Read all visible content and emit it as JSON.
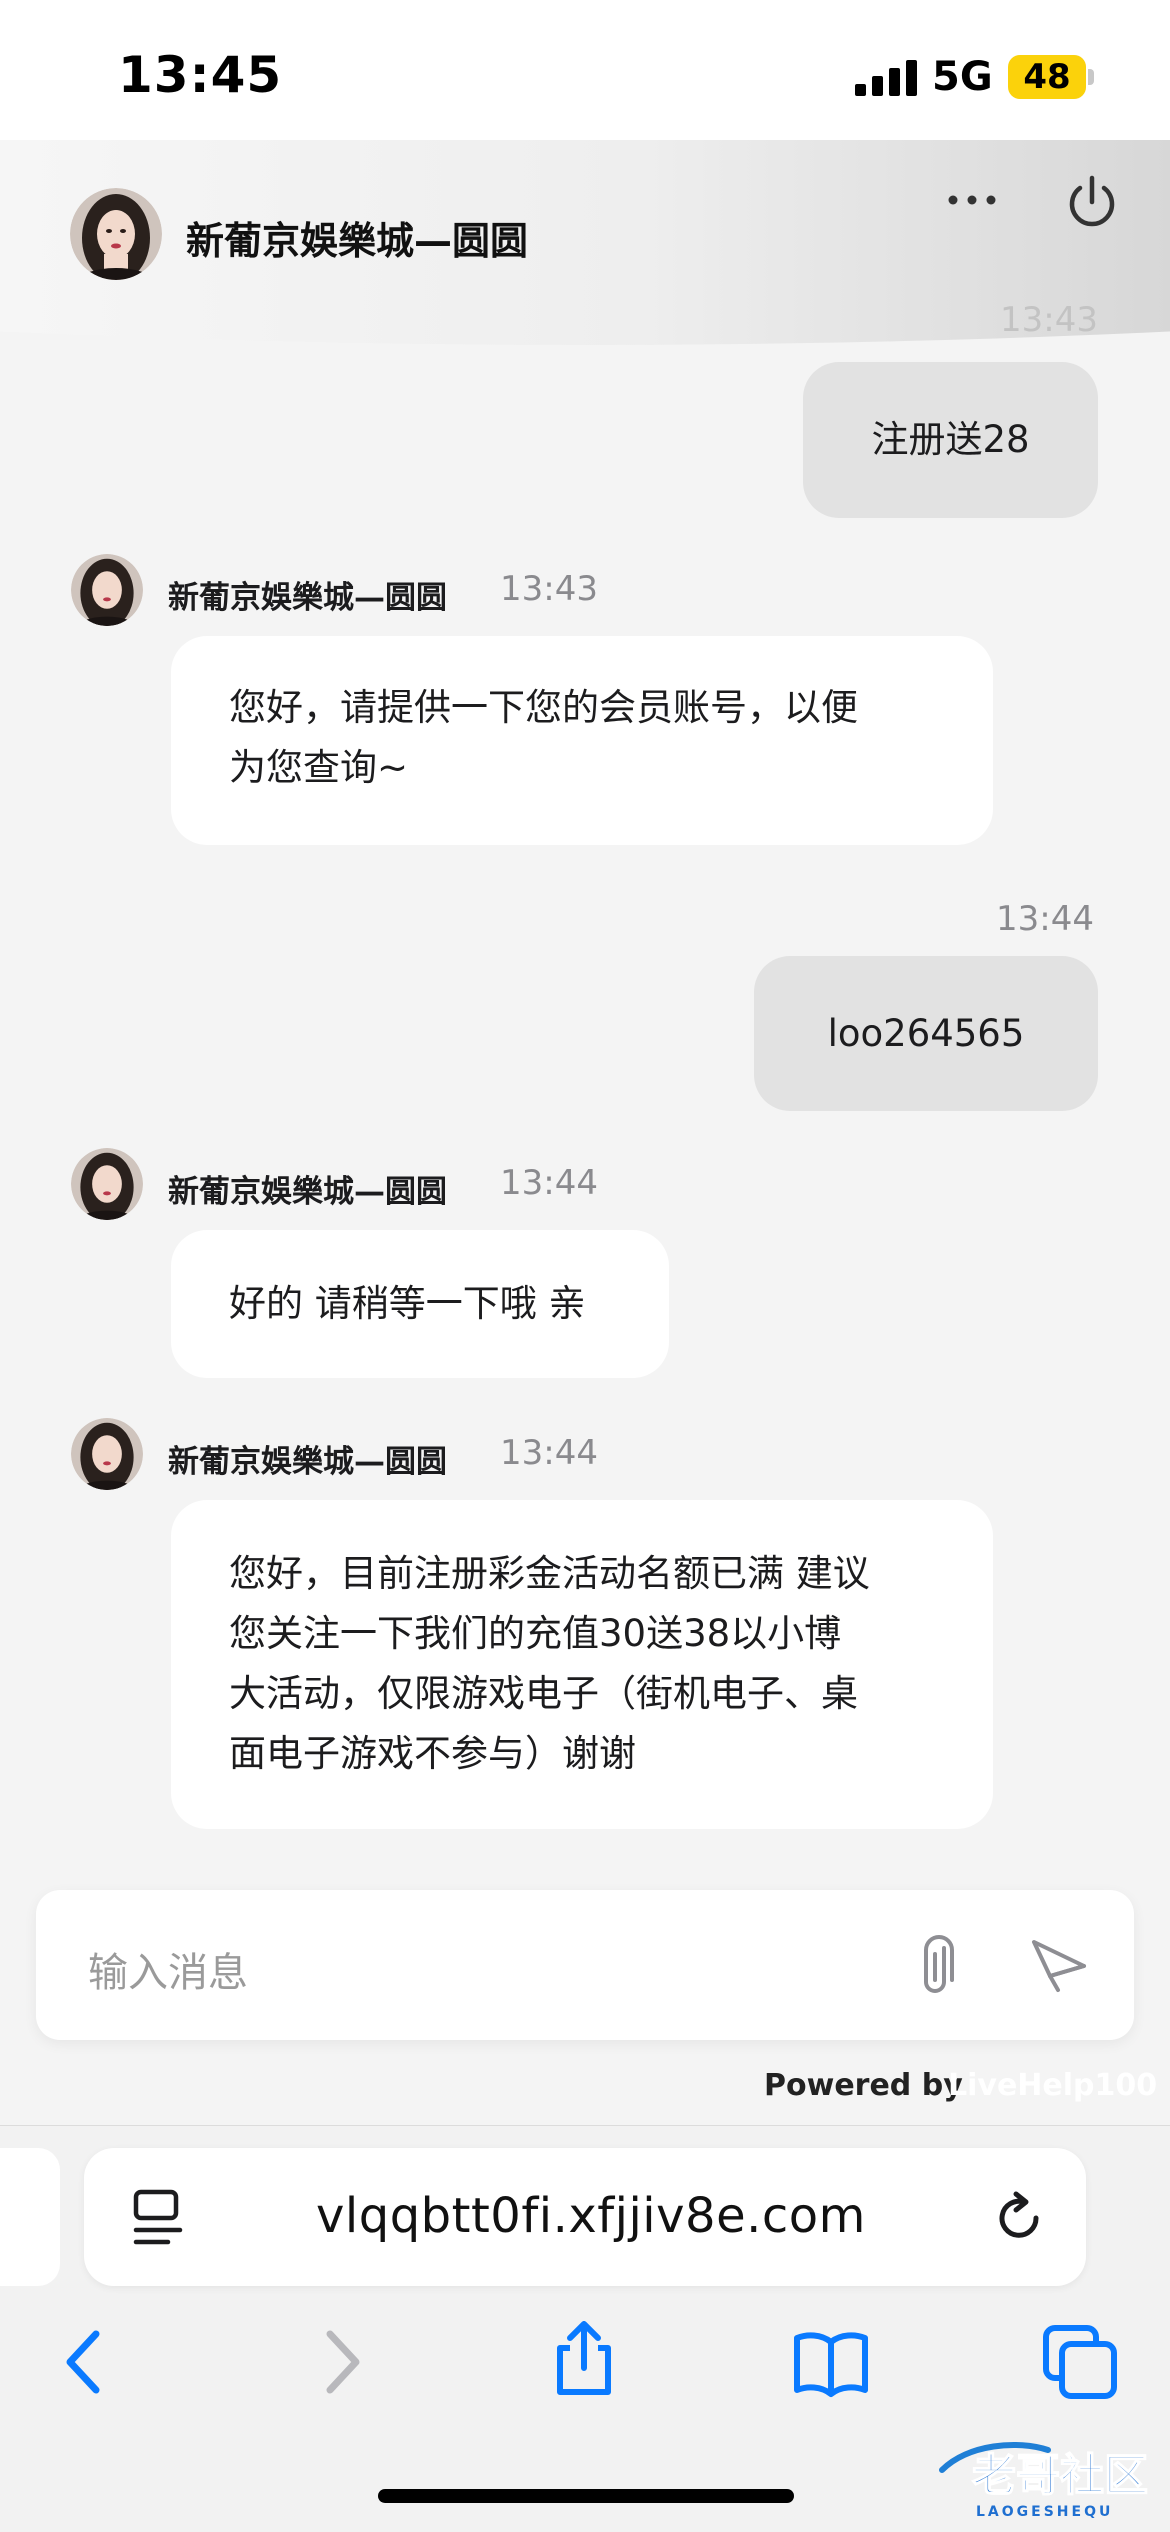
{
  "status_bar": {
    "time": "13:45",
    "network": "5G",
    "battery": "48"
  },
  "header": {
    "title": "新葡京娛樂城—圆圆",
    "more_icon": "ellipsis-icon",
    "power_icon": "power-icon"
  },
  "messages": [
    {
      "from": "user",
      "time": "13:43",
      "text": "注册送28"
    },
    {
      "from": "agent",
      "sender": "新葡京娛樂城—圆圆",
      "time": "13:43",
      "lines": [
        "您好，请提供一下您的会员账号，以便",
        "为您查询~"
      ]
    },
    {
      "from": "user",
      "time": "13:44",
      "text": "loo264565"
    },
    {
      "from": "agent",
      "sender": "新葡京娛樂城—圆圆",
      "time": "13:44",
      "lines": [
        "好的 请稍等一下哦 亲"
      ]
    },
    {
      "from": "agent",
      "sender": "新葡京娛樂城—圆圆",
      "time": "13:44",
      "lines": [
        "您好，目前注册彩金活动名额已满 建议",
        "您关注一下我们的充值30送38以小博",
        "大活动，仅限游戏电子（街机电子、桌",
        "面电子游戏不参与）谢谢"
      ]
    }
  ],
  "composer": {
    "placeholder": "输入消息",
    "attach_icon": "paperclip-icon",
    "send_icon": "send-icon"
  },
  "footer": {
    "powered_label": "Powered by",
    "powered_brand": "LiveHelp100"
  },
  "browser": {
    "url": "vlqqbtt0fi.xfjjiv8e.com",
    "reader_icon": "reader-mode-icon",
    "reload_icon": "reload-icon",
    "toolbar_icons": [
      "back-icon",
      "forward-icon",
      "share-icon",
      "bookmarks-icon",
      "tabs-icon"
    ]
  },
  "watermark": {
    "text": "老哥社区",
    "sub": "LAOGESHEQU"
  },
  "colors": {
    "accent": "#0a7aff",
    "battery": "#fbd20b",
    "user_bubble": "#e2e2e2",
    "agent_bubble": "#ffffff"
  }
}
